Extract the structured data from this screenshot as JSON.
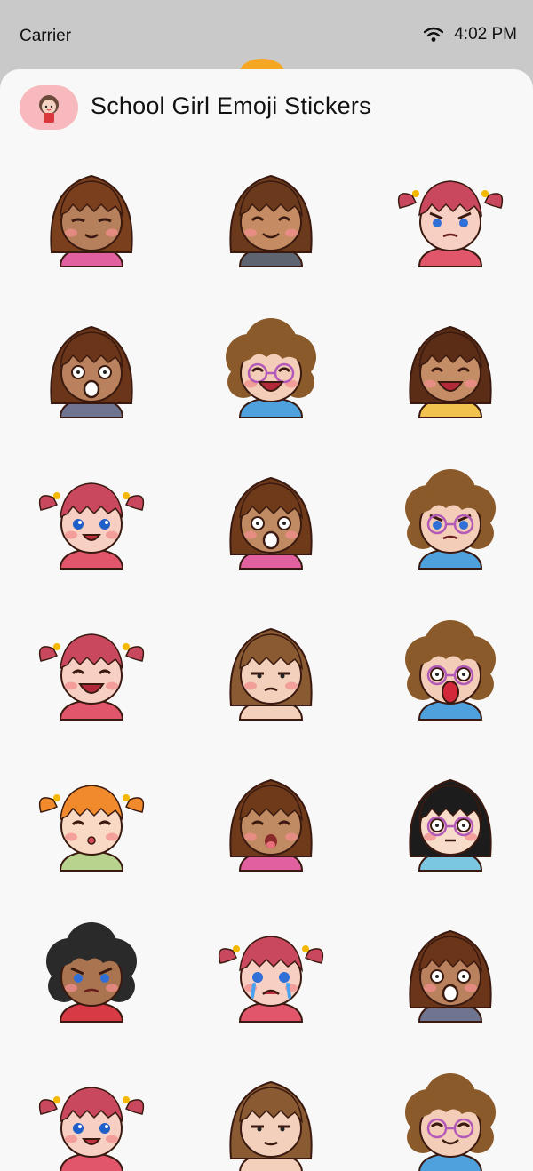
{
  "status_bar": {
    "carrier": "Carrier",
    "time": "4:02 PM",
    "wifi_icon": "wifi-icon"
  },
  "header": {
    "title": "School Girl Emoji Stickers",
    "app_icon": "app-icon"
  },
  "colors": {
    "status_bar_bg": "#c9c9c9",
    "sheet_bg": "#f8f8f8",
    "accent": "#f5a623"
  },
  "stickers": [
    {
      "name": "sticker-girl-peeking-hands",
      "hair": "#7a3f1d",
      "skin": "#b7805c",
      "shirt": "#e060a0",
      "expression": "sly",
      "cheeks": true
    },
    {
      "name": "sticker-girl-with-cat",
      "hair": "#6b3a1c",
      "skin": "#c58c63",
      "shirt": "#5e6470",
      "expression": "smile-closed",
      "cheeks": true
    },
    {
      "name": "sticker-pigtail-girl-angry",
      "hair": "#c9485d",
      "skin": "#f7d0c3",
      "shirt": "#e2566c",
      "expression": "angry",
      "cheeks": false
    },
    {
      "name": "sticker-girl-hands-on-face",
      "hair": "#6a3518",
      "skin": "#b9815e",
      "shirt": "#6f7590",
      "expression": "shocked",
      "cheeks": false
    },
    {
      "name": "sticker-curly-girl-glasses-hearts",
      "hair": "#8a5a2a",
      "skin": "#f4cdb8",
      "shirt": "#4ea1dd",
      "expression": "laugh",
      "cheeks": true
    },
    {
      "name": "sticker-girl-cat-ears-heart",
      "hair": "#5b2d16",
      "skin": "#c58d66",
      "shirt": "#f1c24d",
      "expression": "laugh",
      "cheeks": true
    },
    {
      "name": "sticker-pigtail-girl-smile",
      "hair": "#c9485d",
      "skin": "#f7d0c3",
      "shirt": "#e2566c",
      "expression": "smile-open",
      "cheeks": true
    },
    {
      "name": "sticker-girl-shocked-crown",
      "hair": "#6e3a1a",
      "skin": "#c08a63",
      "shirt": "#e060a0",
      "expression": "shocked",
      "cheeks": true
    },
    {
      "name": "sticker-curly-girl-fire",
      "hair": "#8a5a2a",
      "skin": "#f4cdb8",
      "shirt": "#4ea1dd",
      "expression": "angry",
      "cheeks": false
    },
    {
      "name": "sticker-pigtail-girl-happy-hands",
      "hair": "#c9485d",
      "skin": "#f7d0c3",
      "shirt": "#e2566c",
      "expression": "laugh",
      "cheeks": true
    },
    {
      "name": "sticker-boy-suspicious",
      "hair": "#8a5a32",
      "skin": "#f2d0bb",
      "shirt": "#f2d0bb",
      "expression": "suspicious",
      "cheeks": true
    },
    {
      "name": "sticker-curly-girl-scream",
      "hair": "#8a5a2a",
      "skin": "#f4cdb8",
      "shirt": "#4ea1dd",
      "expression": "scream",
      "cheeks": false
    },
    {
      "name": "sticker-orange-girl-kiss",
      "hair": "#f08a2c",
      "skin": "#f9d9c4",
      "shirt": "#b8d38d",
      "expression": "kiss",
      "cheeks": true
    },
    {
      "name": "sticker-girl-tongue-out",
      "hair": "#6e3a1a",
      "skin": "#c08a63",
      "shirt": "#e060a0",
      "expression": "tongue",
      "cheeks": true
    },
    {
      "name": "sticker-black-hair-girl-confused",
      "hair": "#1c1c1c",
      "skin": "#f6dcc9",
      "shirt": "#7bc6e0",
      "expression": "confused",
      "cheeks": true
    },
    {
      "name": "sticker-dark-curly-girl-angry-fire",
      "hair": "#2a2a2a",
      "skin": "#a9744f",
      "shirt": "#d83a45",
      "expression": "angry",
      "cheeks": true
    },
    {
      "name": "sticker-pigtail-girl-crying",
      "hair": "#c9485d",
      "skin": "#f7d0c3",
      "shirt": "#e2566c",
      "expression": "cry",
      "cheeks": true
    },
    {
      "name": "sticker-girl-shocked-crown-2",
      "hair": "#6a3518",
      "skin": "#b9815e",
      "shirt": "#6f7590",
      "expression": "shocked",
      "cheeks": true
    },
    {
      "name": "sticker-pigtail-girl-partial",
      "hair": "#c9485d",
      "skin": "#f7d0c3",
      "shirt": "#e2566c",
      "expression": "smile-open",
      "cheeks": true
    },
    {
      "name": "sticker-boy-tired-partial",
      "hair": "#8a5a32",
      "skin": "#f2d0bb",
      "shirt": "#f2d0bb",
      "expression": "tired",
      "cheeks": false
    },
    {
      "name": "sticker-curly-girl-partial",
      "hair": "#8a5a2a",
      "skin": "#f4cdb8",
      "shirt": "#4ea1dd",
      "expression": "smile-closed",
      "cheeks": false
    }
  ]
}
